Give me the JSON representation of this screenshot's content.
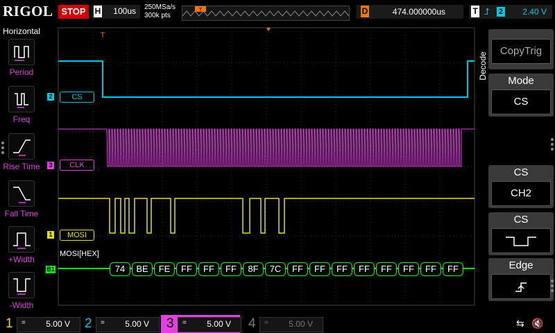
{
  "topbar": {
    "logo": "RIGOL",
    "run_state": "STOP",
    "timebase_key": "H",
    "timebase": "100us",
    "sample_rate": "250MSa/s",
    "mem_depth": "300k pts",
    "delay_key": "D",
    "delay": "474.000000us",
    "trigger_key": "T",
    "trigger_edge_icon": "rising-edge-icon",
    "trigger_channel": "2",
    "trigger_level": "2.40 V"
  },
  "leftbar": {
    "title": "Horizontal",
    "items": [
      {
        "label": "Period",
        "icon": "period-icon"
      },
      {
        "label": "Freq",
        "icon": "freq-icon"
      },
      {
        "label": "Rise Time",
        "icon": "rise-time-icon"
      },
      {
        "label": "Fall Time",
        "icon": "fall-time-icon"
      },
      {
        "label": "+Width",
        "icon": "pos-width-icon"
      },
      {
        "label": "-Width",
        "icon": "neg-width-icon"
      }
    ]
  },
  "screen": {
    "markers": {
      "trigger_pos": "T"
    },
    "channels": [
      {
        "num": "2",
        "label": "CS",
        "color": "#00c8e0"
      },
      {
        "num": "3",
        "label": "CLK",
        "color": "#e040e0"
      },
      {
        "num": "1",
        "label": "MOSI",
        "color": "#e8e000"
      }
    ],
    "bus": {
      "marker": "B1",
      "title": "MOSI[HEX]",
      "color": "#00ff00",
      "bytes": [
        "74",
        "BE",
        "FE",
        "FF",
        "FF",
        "FF",
        "8F",
        "7C",
        "FF",
        "FF",
        "FF",
        "FF",
        "FF",
        "FF",
        "FF",
        "FF"
      ]
    }
  },
  "rightpanel": {
    "menu_title": "Decode",
    "blocks": [
      {
        "head": "",
        "value": "CopyTrig"
      },
      {
        "head": "Mode",
        "value": "CS"
      },
      {
        "head": "CS",
        "value": "CH2"
      },
      {
        "head": "CS",
        "value": "active-low-icon"
      },
      {
        "head": "Edge",
        "value": "rising-edge-icon"
      }
    ]
  },
  "bottombar": {
    "channels": [
      {
        "num": "1",
        "coupling": "=",
        "scale": "5.00 V",
        "color": "#e8e000"
      },
      {
        "num": "2",
        "coupling": "=",
        "scale": "5.00 V",
        "color": "#00c8e0"
      },
      {
        "num": "3",
        "coupling": "=",
        "scale": "5.00 V",
        "color": "#e040e0"
      },
      {
        "num": "4",
        "coupling": "=",
        "scale": "5.00 V",
        "color": "#777777"
      }
    ],
    "usb_icon": "usb-icon",
    "sound_icon": "sound-muted-icon"
  }
}
